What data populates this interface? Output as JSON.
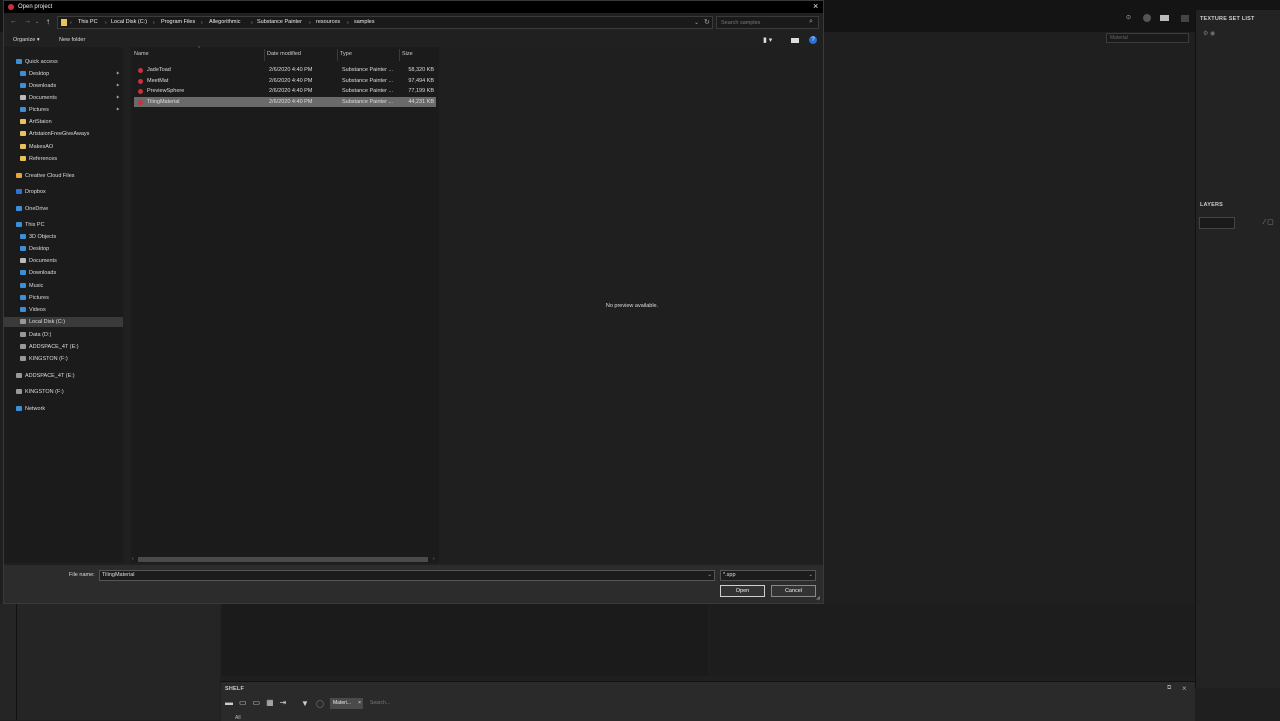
{
  "app": {
    "texture_set_list_title": "TEXTURE SET LIST",
    "material_field_placeholder": "Material",
    "layers_title": "LAYERS",
    "shelf_title": "SHELF",
    "shelf_tab": "Materi...",
    "shelf_search_placeholder": "Search...",
    "shelf_all": "All"
  },
  "dialog": {
    "title": "Open project",
    "breadcrumbs": [
      "This PC",
      "Local Disk (C:)",
      "Program Files",
      "Allegorithmic",
      "Substance Painter",
      "resources",
      "samples"
    ],
    "search_placeholder": "Search samples",
    "organize_label": "Organize",
    "new_folder_label": "New folder",
    "nav": {
      "quick_access": "Quick access",
      "quick_items": [
        "Desktop",
        "Downloads",
        "Documents",
        "Pictures",
        "ArtStaion",
        "ArtstaionFreeGiveAways",
        "MakesAO",
        "References"
      ],
      "creative_cloud": "Creative Cloud Files",
      "dropbox": "Dropbox",
      "onedrive": "OneDrive",
      "this_pc": "This PC",
      "pc_items": [
        "3D Objects",
        "Desktop",
        "Documents",
        "Downloads",
        "Music",
        "Pictures",
        "Videos",
        "Local Disk (C:)",
        "Data (D:)",
        "ADDSPACE_4T (E:)",
        "KINGSTON (F:)"
      ],
      "addspace": "ADDSPACE_4T (E:)",
      "kingston": "KINGSTON (F:)",
      "network": "Network"
    },
    "columns": {
      "name": "Name",
      "date": "Date modified",
      "type": "Type",
      "size": "Size"
    },
    "files": [
      {
        "name": "JadeToad",
        "date": "2/6/2020 4:40 PM",
        "type": "Substance Painter ...",
        "size": "58,320 KB"
      },
      {
        "name": "MeetMat",
        "date": "2/6/2020 4:40 PM",
        "type": "Substance Painter ...",
        "size": "97,494 KB"
      },
      {
        "name": "PreviewSphere",
        "date": "2/6/2020 4:40 PM",
        "type": "Substance Painter ...",
        "size": "77,199 KB"
      },
      {
        "name": "TilingMaterial",
        "date": "2/6/2020 4:40 PM",
        "type": "Substance Painter ...",
        "size": "44,231 KB"
      }
    ],
    "preview_text": "No preview available.",
    "file_name_label": "File name:",
    "file_name_value": "TilingMaterial",
    "file_type_value": "*.spp",
    "open_label": "Open",
    "cancel_label": "Cancel"
  },
  "colors": {
    "selected_row": "#6a6a6a",
    "file_icon": "#c8323c",
    "folder": "#e8c35a"
  }
}
